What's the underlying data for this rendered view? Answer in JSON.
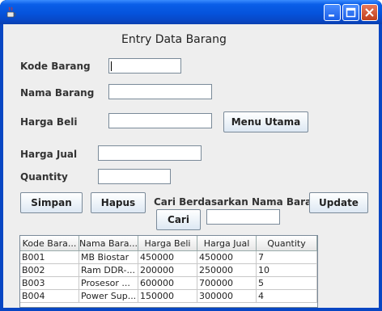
{
  "window": {
    "title": ""
  },
  "form": {
    "title": "Entry Data Barang",
    "kode_barang": {
      "label": "Kode Barang",
      "value": ""
    },
    "nama_barang": {
      "label": "Nama Barang",
      "value": ""
    },
    "harga_beli": {
      "label": "Harga Beli",
      "value": ""
    },
    "harga_jual": {
      "label": "Harga Jual",
      "value": ""
    },
    "quantity": {
      "label": "Quantity",
      "value": ""
    },
    "search_label": "Cari Berdasarkan Nama Barang",
    "search_value": ""
  },
  "buttons": {
    "menu_utama": "Menu Utama",
    "simpan": "Simpan",
    "hapus": "Hapus",
    "update": "Update",
    "cari": "Cari"
  },
  "table": {
    "columns": [
      "Kode Bara...",
      "Nama Bara...",
      "Harga Beli",
      "Harga Jual",
      "Quantity"
    ],
    "rows": [
      [
        "B001",
        "MB Biostar",
        "450000",
        "450000",
        "7"
      ],
      [
        "B002",
        "Ram DDR-...",
        "200000",
        "250000",
        "10"
      ],
      [
        "B003",
        "Prosesor ...",
        "600000",
        "700000",
        "5"
      ],
      [
        "B004",
        "Power Sup...",
        "150000",
        "300000",
        "4"
      ]
    ]
  }
}
